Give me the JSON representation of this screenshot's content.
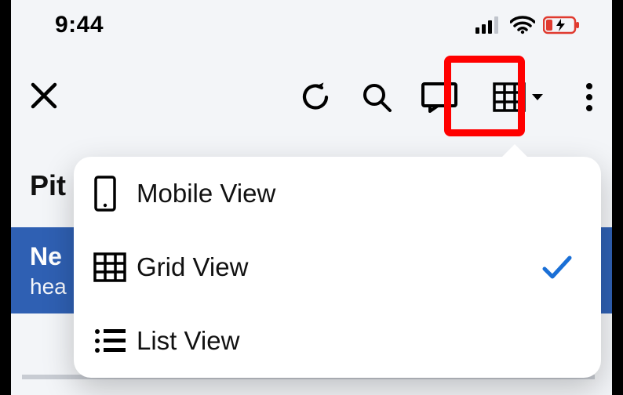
{
  "status_bar": {
    "time": "9:44"
  },
  "toolbar": {
    "view_button": {
      "selected_view": "grid"
    }
  },
  "page": {
    "title_visible_fragment": "Pit"
  },
  "banner": {
    "line1_visible_fragment": "Ne",
    "line2_visible_fragment": "hea"
  },
  "view_menu": {
    "items": [
      {
        "label": "Mobile View",
        "icon": "mobile-icon",
        "selected": false
      },
      {
        "label": "Grid View",
        "icon": "grid-icon",
        "selected": true
      },
      {
        "label": "List View",
        "icon": "list-icon",
        "selected": false
      }
    ]
  },
  "highlight": {
    "target": "view-switch-button"
  }
}
